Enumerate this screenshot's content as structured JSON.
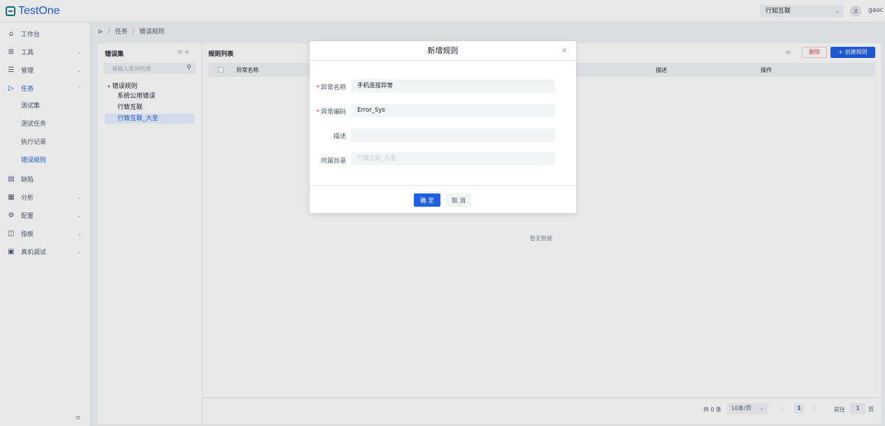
{
  "app": {
    "logo_text": "TestOne"
  },
  "header": {
    "project": "行知互联",
    "user_initial": "ㄡ",
    "user_name": "gaoc"
  },
  "sidebar": {
    "items": [
      {
        "label": "工作台",
        "icon": "home-icon"
      },
      {
        "label": "工具",
        "icon": "grid-icon"
      },
      {
        "label": "管理",
        "icon": "list-icon"
      },
      {
        "label": "任务",
        "icon": "play-icon"
      },
      {
        "label": "缺陷",
        "icon": "document-icon"
      },
      {
        "label": "分析",
        "icon": "calendar-icon"
      },
      {
        "label": "配置",
        "icon": "gear-icon"
      },
      {
        "label": "指板",
        "icon": "board-icon"
      },
      {
        "label": "真机调试",
        "icon": "device-icon"
      }
    ],
    "task_sub": [
      "测试集",
      "测试任务",
      "执行记录",
      "错误规则"
    ],
    "collapse_glyph": "≡"
  },
  "breadcrumb": {
    "root": "⊳",
    "level1": "任务",
    "level2": "错误规则"
  },
  "tree": {
    "title": "错误集",
    "search_placeholder": "请输入查询内容",
    "root": "错误规则",
    "children": [
      "系统公用错误",
      "行致互联",
      "行致互联_大圣"
    ]
  },
  "main": {
    "title": "规则列表",
    "delete_label": "删除",
    "create_label": "+ 创建规则",
    "columns": [
      "异常名称",
      "描述",
      "操作"
    ],
    "empty": "暂无数据"
  },
  "pagination": {
    "total": "共 0 条",
    "page_size": "10条/页",
    "current": "1",
    "goto": "前往",
    "goto_value": "1",
    "unit": "页"
  },
  "modal": {
    "title": "新增规则",
    "fields": [
      {
        "label": "异常名称",
        "required": true,
        "value": "手机连接异常"
      },
      {
        "label": "异常编码",
        "required": true,
        "value": "Error_Sys"
      },
      {
        "label": "描述",
        "required": false,
        "value": ""
      },
      {
        "label": "所属目录",
        "required": false,
        "value": "行致互联_大圣"
      }
    ],
    "ok_label": "确 定",
    "cancel_label": "取 消"
  },
  "colors": {
    "primary": "#1d5fe6",
    "danger": "#f53f3f"
  }
}
